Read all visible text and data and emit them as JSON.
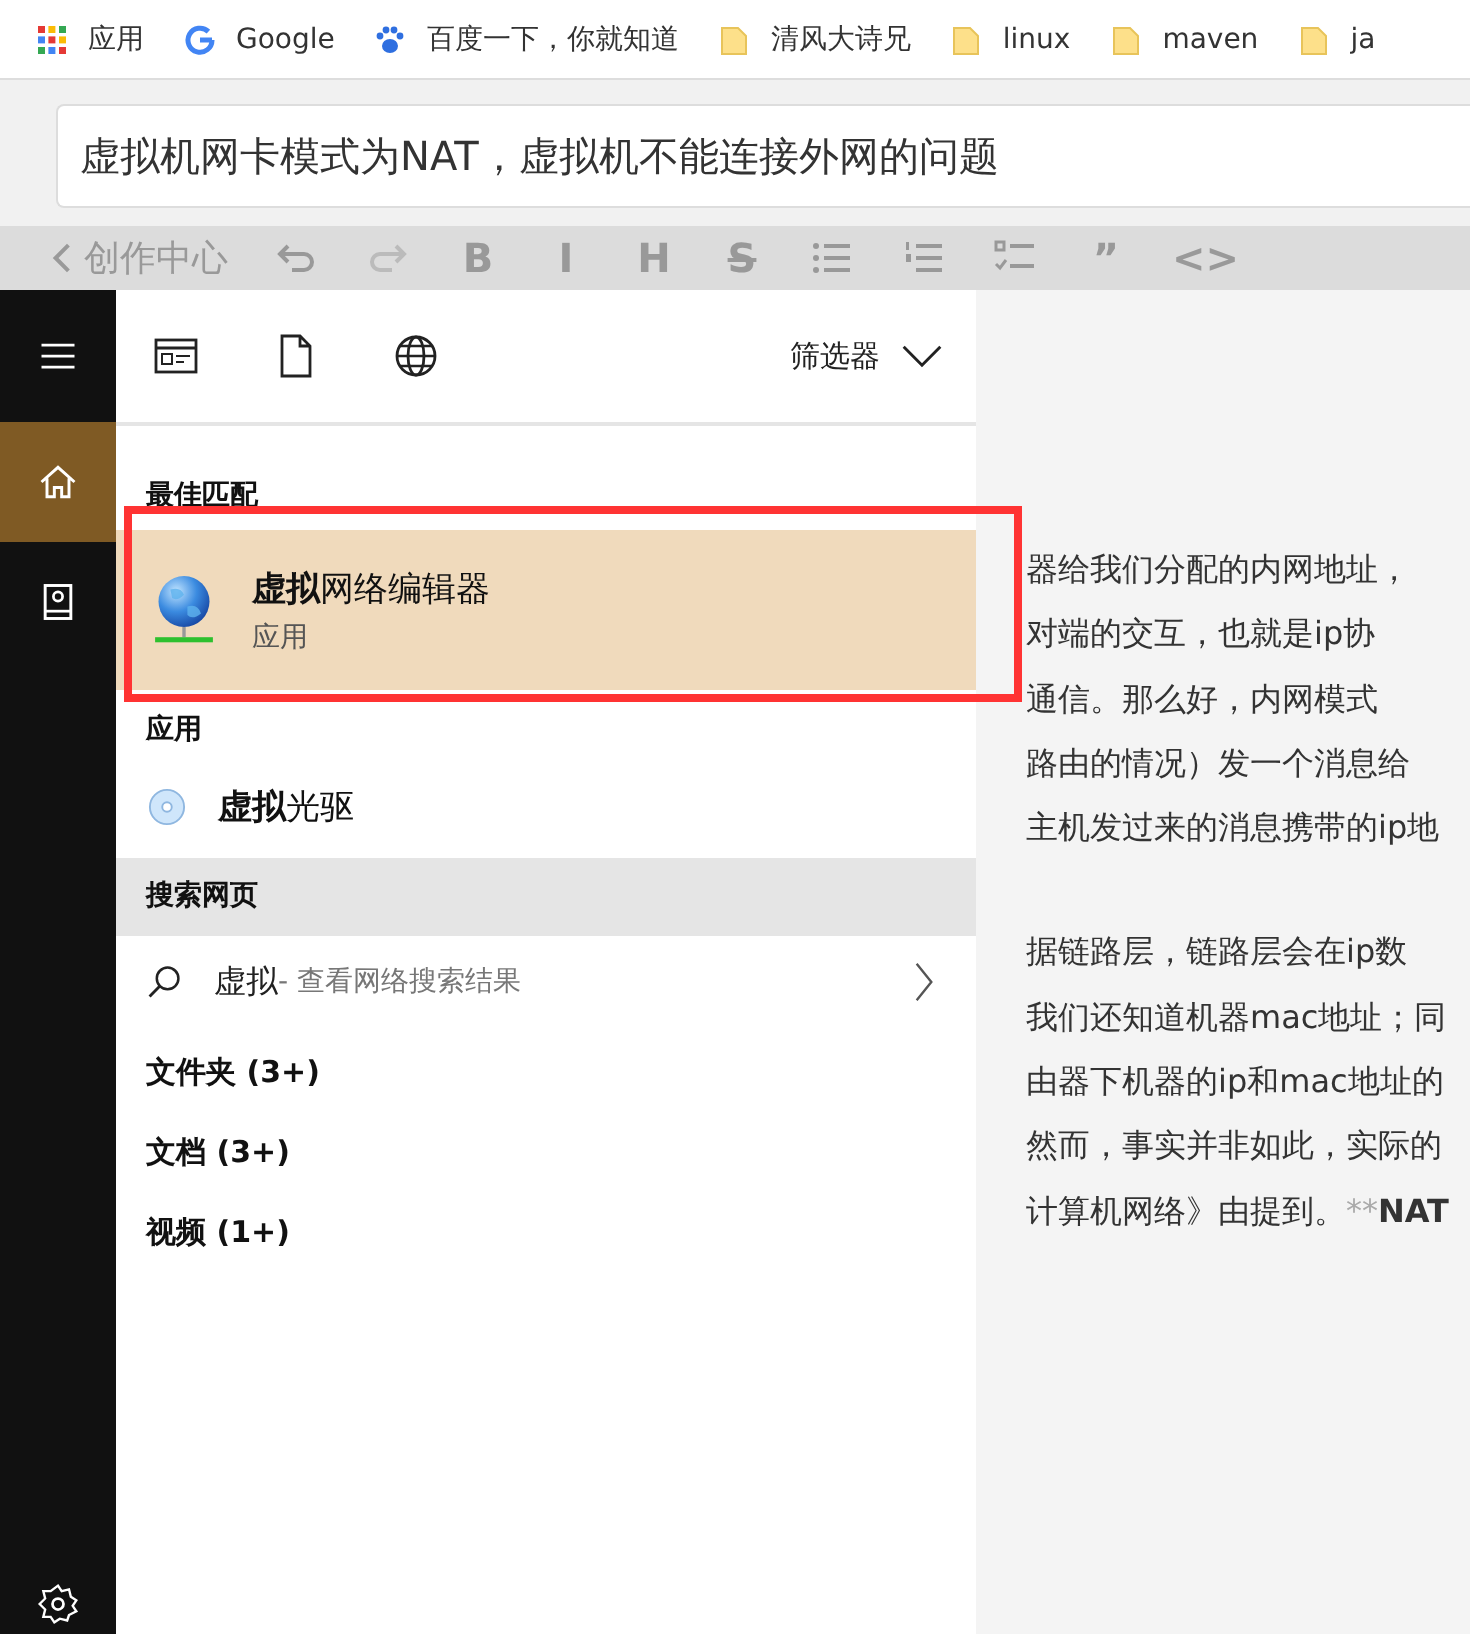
{
  "bookmarks": [
    {
      "kind": "apps",
      "label": "应用"
    },
    {
      "kind": "google",
      "label": "Google"
    },
    {
      "kind": "paw",
      "label": "百度一下，你就知道"
    },
    {
      "kind": "folder",
      "label": "清风大诗兄"
    },
    {
      "kind": "folder",
      "label": "linux"
    },
    {
      "kind": "folder",
      "label": "maven"
    },
    {
      "kind": "folder",
      "label": "ja"
    }
  ],
  "article_title": "虚拟机网卡模式为NAT，虚拟机不能连接外网的问题",
  "editor_toolbar": {
    "back_label": "创作中心",
    "tools": [
      {
        "kind": "undo"
      },
      {
        "kind": "redo"
      },
      {
        "kind": "text",
        "label": "B"
      },
      {
        "kind": "text",
        "label": "I"
      },
      {
        "kind": "text",
        "label": "H"
      },
      {
        "kind": "strike",
        "label": "S"
      },
      {
        "kind": "ul"
      },
      {
        "kind": "ol"
      },
      {
        "kind": "check"
      },
      {
        "kind": "text",
        "label": "”"
      },
      {
        "kind": "text",
        "label": "<>"
      }
    ]
  },
  "article_lines": [
    {
      "text": "器给我们分配的内网地址，"
    },
    {
      "text": "对端的交互，也就是ip协"
    },
    {
      "text": "通信。那么好，内网模式"
    },
    {
      "text": "路由的情况）发一个消息给"
    },
    {
      "text": "主机发过来的消息携带的ip地"
    },
    {
      "text": "据链路层，链路层会在ip数",
      "new_paragraph": true
    },
    {
      "text": "我们还知道机器mac地址；同"
    },
    {
      "text": "由器下机器的ip和mac地址的"
    },
    {
      "text": "然而，事实并非如此，实际的"
    },
    {
      "text": "计算机网络》由提到。",
      "faded": "**",
      "strong": "NAT"
    }
  ],
  "start_sidebar": {
    "items": [
      {
        "kind": "home",
        "selected": true
      },
      {
        "kind": "book",
        "selected": false
      }
    ]
  },
  "search_panel": {
    "filter_label": "筛选器",
    "best_match_heading": "最佳匹配",
    "best_match": {
      "title": "**虚拟**网络编辑器",
      "subtitle": "应用",
      "selected": true
    },
    "apps_heading": "应用",
    "apps": [
      {
        "title": "**虚拟**光驱"
      }
    ],
    "web_heading": "搜索网页",
    "web_result": {
      "query": "虚拟",
      "hint": " - 查看网络搜索结果"
    },
    "categories": [
      "文件夹 (3+)",
      "文档 (3+)",
      "视频 (1+)"
    ]
  }
}
